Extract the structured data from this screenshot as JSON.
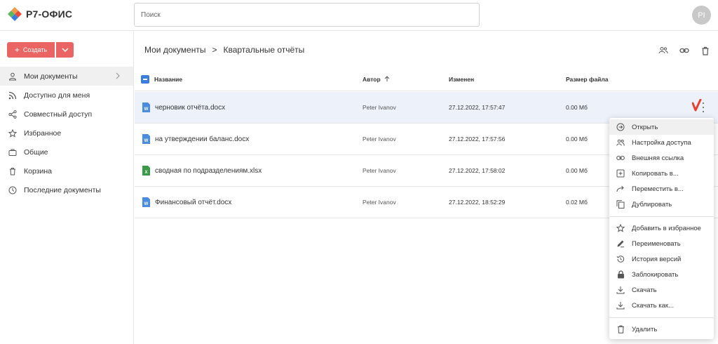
{
  "app": {
    "name": "Р7-ОФИС"
  },
  "search": {
    "placeholder": "Поиск"
  },
  "user": {
    "initials": "PI"
  },
  "create": {
    "label": "Создать"
  },
  "sidebar": {
    "items": [
      {
        "label": "Мои документы",
        "icon": "user-icon",
        "active": true
      },
      {
        "label": "Доступно для меня",
        "icon": "rss-icon"
      },
      {
        "label": "Совместный доступ",
        "icon": "share-icon"
      },
      {
        "label": "Избранное",
        "icon": "star-icon"
      },
      {
        "label": "Общие",
        "icon": "briefcase-icon"
      },
      {
        "label": "Корзина",
        "icon": "trash-icon"
      },
      {
        "label": "Последние документы",
        "icon": "clock-icon"
      }
    ]
  },
  "breadcrumb": {
    "parent": "Мои документы",
    "separator": ">",
    "current": "Квартальные отчёты"
  },
  "table": {
    "headers": {
      "name": "Название",
      "author": "Автор",
      "modified": "Изменен",
      "size": "Размер файла"
    },
    "rows": [
      {
        "name": "черновик отчёта.docx",
        "type": "docx",
        "author": "Peter Ivanov",
        "modified": "27.12.2022, 17:57:47",
        "size": "0.00 Мб",
        "selected": true
      },
      {
        "name": "на утверждении баланс.docx",
        "type": "docx",
        "author": "Peter Ivanov",
        "modified": "27.12.2022, 17:57:56",
        "size": "0.00 Мб"
      },
      {
        "name": "сводная по подразделениям.xlsx",
        "type": "xlsx",
        "author": "Peter Ivanov",
        "modified": "27.12.2022, 17:58:02",
        "size": "0.00 Мб"
      },
      {
        "name": "Финансовый отчёт.docx",
        "type": "docx",
        "author": "Peter Ivanov",
        "modified": "27.12.2022, 18:52:29",
        "size": "0.02 Мб"
      }
    ]
  },
  "context_menu": {
    "items": [
      {
        "label": "Открыть",
        "icon": "open-icon"
      },
      {
        "label": "Настройка доступа",
        "icon": "people-icon"
      },
      {
        "label": "Внешняя ссылка",
        "icon": "link-icon"
      },
      {
        "label": "Копировать в...",
        "icon": "copy-to-icon"
      },
      {
        "label": "Переместить в...",
        "icon": "move-icon"
      },
      {
        "label": "Дублировать",
        "icon": "duplicate-icon"
      },
      {
        "label": "Добавить в избранное",
        "icon": "star-icon"
      },
      {
        "label": "Переименовать",
        "icon": "pencil-icon"
      },
      {
        "label": "История версий",
        "icon": "history-icon"
      },
      {
        "label": "Заблокировать",
        "icon": "lock-icon"
      },
      {
        "label": "Скачать",
        "icon": "download-icon"
      },
      {
        "label": "Скачать как...",
        "icon": "download-as-icon"
      },
      {
        "label": "Удалить",
        "icon": "trash-icon"
      }
    ]
  },
  "colors": {
    "accent": "#ea6464",
    "primary": "#3b7ddd",
    "docx": "#4a8ce0",
    "xlsx": "#3a9a48"
  }
}
